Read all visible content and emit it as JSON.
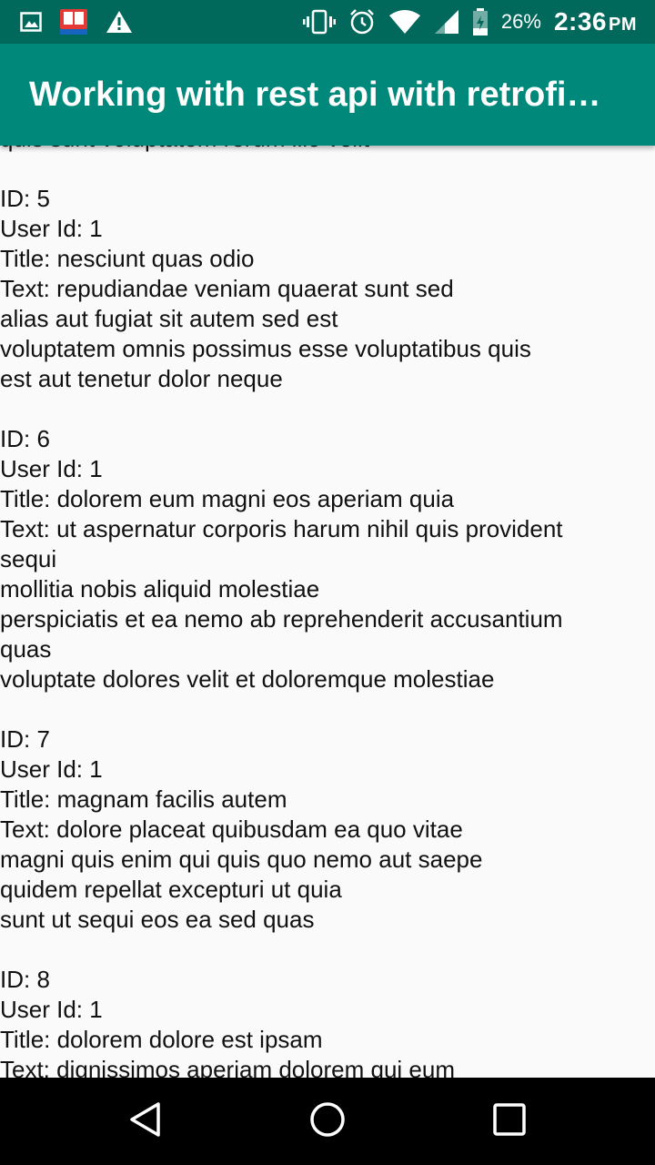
{
  "status_bar": {
    "battery_percent": "26%",
    "time": "2:36",
    "ampm": "PM",
    "icons": [
      "gallery-icon",
      "app-notification-icon",
      "warning-icon",
      "vibrate-icon",
      "alarm-icon",
      "wifi-icon",
      "signal-icon",
      "battery-icon"
    ]
  },
  "app_bar": {
    "title": "Working with rest api with retrofit..."
  },
  "content": {
    "partial_top_line": "quis sunt voluptatem rerum illo velit",
    "posts": [
      {
        "id_line": "ID: 5",
        "user_line": "User Id: 1",
        "title_line": "Title: nesciunt quas odio",
        "text_lines": [
          "Text: repudiandae veniam quaerat sunt sed",
          "alias aut fugiat sit autem sed est",
          "voluptatem omnis possimus esse voluptatibus quis",
          "est aut tenetur dolor neque"
        ]
      },
      {
        "id_line": "ID: 6",
        "user_line": "User Id: 1",
        "title_line": "Title: dolorem eum magni eos aperiam quia",
        "text_lines": [
          "Text: ut aspernatur corporis harum nihil quis provident",
          "sequi",
          "mollitia nobis aliquid molestiae",
          "perspiciatis et ea nemo ab reprehenderit accusantium",
          "quas",
          "voluptate dolores velit et doloremque molestiae"
        ]
      },
      {
        "id_line": "ID: 7",
        "user_line": "User Id: 1",
        "title_line": "Title: magnam facilis autem",
        "text_lines": [
          "Text: dolore placeat quibusdam ea quo vitae",
          "magni quis enim qui quis quo nemo aut saepe",
          "quidem repellat excepturi ut quia",
          "sunt ut sequi eos ea sed quas"
        ]
      },
      {
        "id_line": "ID: 8",
        "user_line": "User Id: 1",
        "title_line": "Title: dolorem dolore est ipsam",
        "text_lines": [
          "Text: dignissimos aperiam dolorem qui eum"
        ]
      }
    ]
  },
  "nav_bar": {
    "buttons": [
      "back-button",
      "home-button",
      "recents-button"
    ]
  },
  "colors": {
    "status_bar": "#00695c",
    "app_bar": "#00897b",
    "background": "#fafafa",
    "nav_bar": "#000000"
  }
}
